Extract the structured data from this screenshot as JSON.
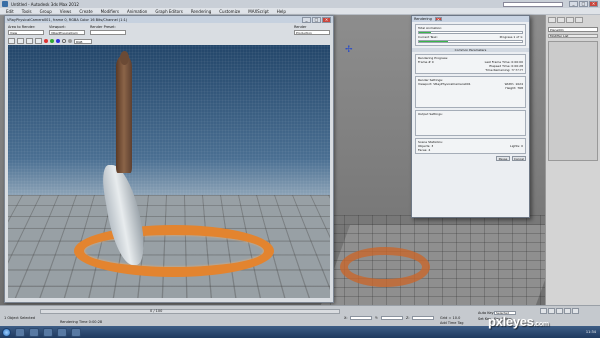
{
  "app": {
    "title": "Untitled - Autodesk 3ds Max 2012",
    "search_placeholder": "Type a keyword or phrase",
    "menu": [
      "Edit",
      "Tools",
      "Group",
      "Views",
      "Create",
      "Modifiers",
      "Animation",
      "Graph Editors",
      "Rendering",
      "Customize",
      "MAXScript",
      "Help"
    ]
  },
  "frame_buffer": {
    "title": "VRayPhysicalCamera001, frame 0, RGBA Color 16 Bits/Channel (1:1)",
    "area_label": "Area to Render:",
    "area_value": "View",
    "viewport_label": "Viewport:",
    "viewport_value": "VRayPhysicalCam",
    "preset_label": "Render Preset:",
    "preset_value": "",
    "render_label": "Render",
    "render_mode": "Production",
    "channel_value": "RGB Alpha"
  },
  "rendering_dialog": {
    "title": "Rendering",
    "total_animation_label": "Total Animation:",
    "current_task_label": "Current Task:",
    "current_task_value": "Progress 1 of 1:",
    "total_progress": 0.12,
    "task_progress": 0.28,
    "common_params_header": "Common Parameters",
    "rendering_progress_label": "Rendering Progress:",
    "frame_label": "Frame #",
    "frame_value": "0",
    "last_frame_label": "Last Frame Time:",
    "last_frame_value": "0:00:00",
    "elapsed_label": "Elapsed Time:",
    "elapsed_value": "0:00:28",
    "remaining_label": "Time Remaining:",
    "remaining_value": "??:??:??",
    "render_settings_header": "Render Settings:",
    "viewport_label": "Viewport:",
    "viewport_value": "VRayPhysicalCamera001",
    "width_label": "Width:",
    "width_value": "1024",
    "height_label": "Height:",
    "height_value": "768",
    "output_header": "Output Settings:",
    "scene_stats_header": "Scene Statistics:",
    "objects_label": "Objects:",
    "objects_value": "3",
    "lights_label": "Lights:",
    "lights_value": "0",
    "faces_label": "Faces:",
    "faces_value": "4",
    "pause_label": "Pause",
    "cancel_label": "Cancel"
  },
  "command_panel": {
    "name_field": "Plane001",
    "modifier_list": "Modifier List"
  },
  "status": {
    "selected": "1 Object Selected",
    "hint": "Rendering Time  0:00:28",
    "x_label": "X:",
    "y_label": "Y:",
    "z_label": "Z:",
    "grid": "Grid = 10.0",
    "auto_key": "Auto Key",
    "selected_mode": "Selected",
    "set_key": "Set Key",
    "key_filters": "Key Filters...",
    "add_time_tag": "Add Time Tag",
    "frame_counter": "0 / 100"
  },
  "taskbar": {
    "clock": "11:34"
  },
  "watermark": {
    "main": "pxleyes",
    "suffix": ".com"
  }
}
